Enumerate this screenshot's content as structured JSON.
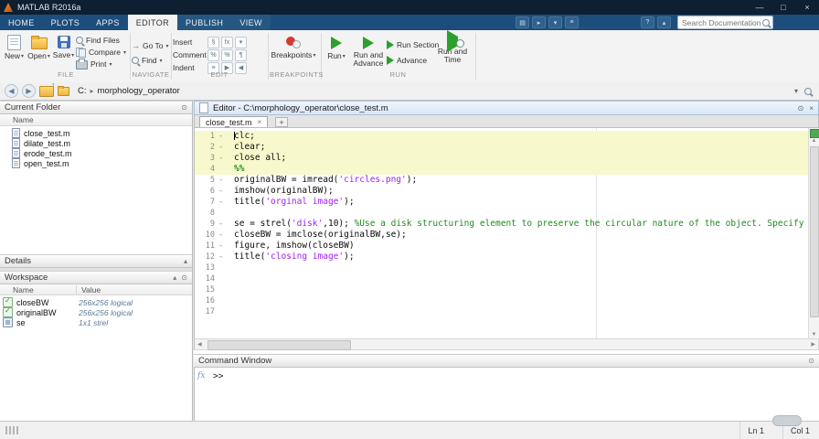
{
  "colors": {
    "titlebar_bg": "#0d1f30",
    "tabstrip_bg": "#1d4e7b",
    "run_green": "#2ca02c",
    "string_purple": "#a020f0",
    "comment_green": "#1e8a1e",
    "section_highlight": "#f8f8cd",
    "analyzer_ok_green": "#52a852"
  },
  "icons": {
    "caret_down": "▾",
    "collapse_up": "▴",
    "close": "×",
    "plus": "+",
    "panel_menu": "⊙",
    "minimize": "—",
    "maximize": "□",
    "back": "◀",
    "forward": "▶",
    "breadcrumb_sep": "▸",
    "scroll_up": "▲",
    "scroll_down": "▼",
    "scroll_left": "◀",
    "scroll_right": "▶",
    "fx": "fx"
  },
  "titlebar": {
    "title": "MATLAB R2016a"
  },
  "tabstrip": {
    "tabs": [
      {
        "label": "HOME",
        "ctx": false
      },
      {
        "label": "PLOTS",
        "ctx": false
      },
      {
        "label": "APPS",
        "ctx": false
      },
      {
        "label": "EDITOR",
        "ctx": true
      },
      {
        "label": "PUBLISH",
        "ctx": true
      },
      {
        "label": "VIEW",
        "ctx": true
      }
    ],
    "active": "EDITOR",
    "search_placeholder": "Search Documentation"
  },
  "ribbon": {
    "file": {
      "label": "FILE",
      "new": "New",
      "open": "Open",
      "save": "Save",
      "find_files": "Find Files",
      "compare": "Compare",
      "print": "Print"
    },
    "navigate": {
      "label": "NAVIGATE",
      "go_to": "Go To",
      "find": "Find"
    },
    "edit": {
      "label": "EDIT",
      "insert": "Insert",
      "comment": "Comment",
      "indent": "Indent",
      "fx": "fx",
      "percent": "%",
      "pilcrow": "¶",
      "sect": "§",
      "indent_glyph": "≡"
    },
    "breakpoints": {
      "label": "BREAKPOINTS",
      "button": "Breakpoints"
    },
    "run": {
      "label": "RUN",
      "run": "Run",
      "run_and_advance": "Run and Advance",
      "run_section": "Run Section",
      "advance": "Advance",
      "run_and_time": "Run and Time"
    }
  },
  "addressbar": {
    "drive": "C:",
    "folder": "morphology_operator"
  },
  "current_folder": {
    "title": "Current Folder",
    "column": "Name",
    "files": [
      "close_test.m",
      "dilate_test.m",
      "erode_test.m",
      "open_test.m"
    ]
  },
  "details": {
    "title": "Details"
  },
  "workspace": {
    "title": "Workspace",
    "columns": {
      "name": "Name",
      "value": "Value"
    },
    "rows": [
      {
        "icon": "logical",
        "name": "closeBW",
        "value": "256x256 logical"
      },
      {
        "icon": "logical",
        "name": "originalBW",
        "value": "256x256 logical"
      },
      {
        "icon": "object",
        "name": "se",
        "value": "1x1 strel"
      }
    ]
  },
  "editor": {
    "title": "Editor - C:\\morphology_operator\\close_test.m",
    "tab": "close_test.m",
    "cursor_line": 1,
    "lines": [
      {
        "n": 1,
        "d": true,
        "hl": true,
        "s": [
          {
            "t": "clc;",
            "c": "p"
          }
        ]
      },
      {
        "n": 2,
        "d": true,
        "hl": true,
        "s": [
          {
            "t": "clear;",
            "c": "p"
          }
        ]
      },
      {
        "n": 3,
        "d": true,
        "hl": true,
        "s": [
          {
            "t": "close all;",
            "c": "p"
          }
        ]
      },
      {
        "n": 4,
        "d": false,
        "hl": true,
        "s": [
          {
            "t": "%%",
            "c": "sec"
          }
        ]
      },
      {
        "n": 5,
        "d": true,
        "hl": false,
        "s": [
          {
            "t": "originalBW = imread(",
            "c": "p"
          },
          {
            "t": "'circles.png'",
            "c": "s"
          },
          {
            "t": ");",
            "c": "p"
          }
        ]
      },
      {
        "n": 6,
        "d": true,
        "hl": false,
        "s": [
          {
            "t": "imshow(originalBW);",
            "c": "p"
          }
        ]
      },
      {
        "n": 7,
        "d": true,
        "hl": false,
        "s": [
          {
            "t": "title(",
            "c": "p"
          },
          {
            "t": "'orginal image'",
            "c": "s"
          },
          {
            "t": ");",
            "c": "p"
          }
        ]
      },
      {
        "n": 8,
        "d": false,
        "hl": false,
        "s": []
      },
      {
        "n": 9,
        "d": true,
        "hl": false,
        "s": [
          {
            "t": "se = strel(",
            "c": "p"
          },
          {
            "t": "'disk'",
            "c": "s"
          },
          {
            "t": ",10); ",
            "c": "p"
          },
          {
            "t": "%Use a disk structuring element to preserve the circular nature of the object. Specify a radius o",
            "c": "c"
          }
        ]
      },
      {
        "n": 10,
        "d": true,
        "hl": false,
        "s": [
          {
            "t": "closeBW = imclose(originalBW,se);",
            "c": "p"
          }
        ]
      },
      {
        "n": 11,
        "d": true,
        "hl": false,
        "s": [
          {
            "t": "figure, imshow(closeBW)",
            "c": "p"
          }
        ]
      },
      {
        "n": 12,
        "d": true,
        "hl": false,
        "s": [
          {
            "t": "title(",
            "c": "p"
          },
          {
            "t": "'closing image'",
            "c": "s"
          },
          {
            "t": ");",
            "c": "p"
          }
        ]
      },
      {
        "n": 13,
        "d": false,
        "hl": false,
        "s": []
      },
      {
        "n": 14,
        "d": false,
        "hl": false,
        "s": []
      },
      {
        "n": 15,
        "d": false,
        "hl": false,
        "s": []
      },
      {
        "n": 16,
        "d": false,
        "hl": false,
        "s": []
      },
      {
        "n": 17,
        "d": false,
        "hl": false,
        "s": []
      }
    ]
  },
  "command_window": {
    "title": "Command Window",
    "prompt": ">>"
  },
  "status": {
    "ln": "Ln  1",
    "col": "Col  1"
  }
}
